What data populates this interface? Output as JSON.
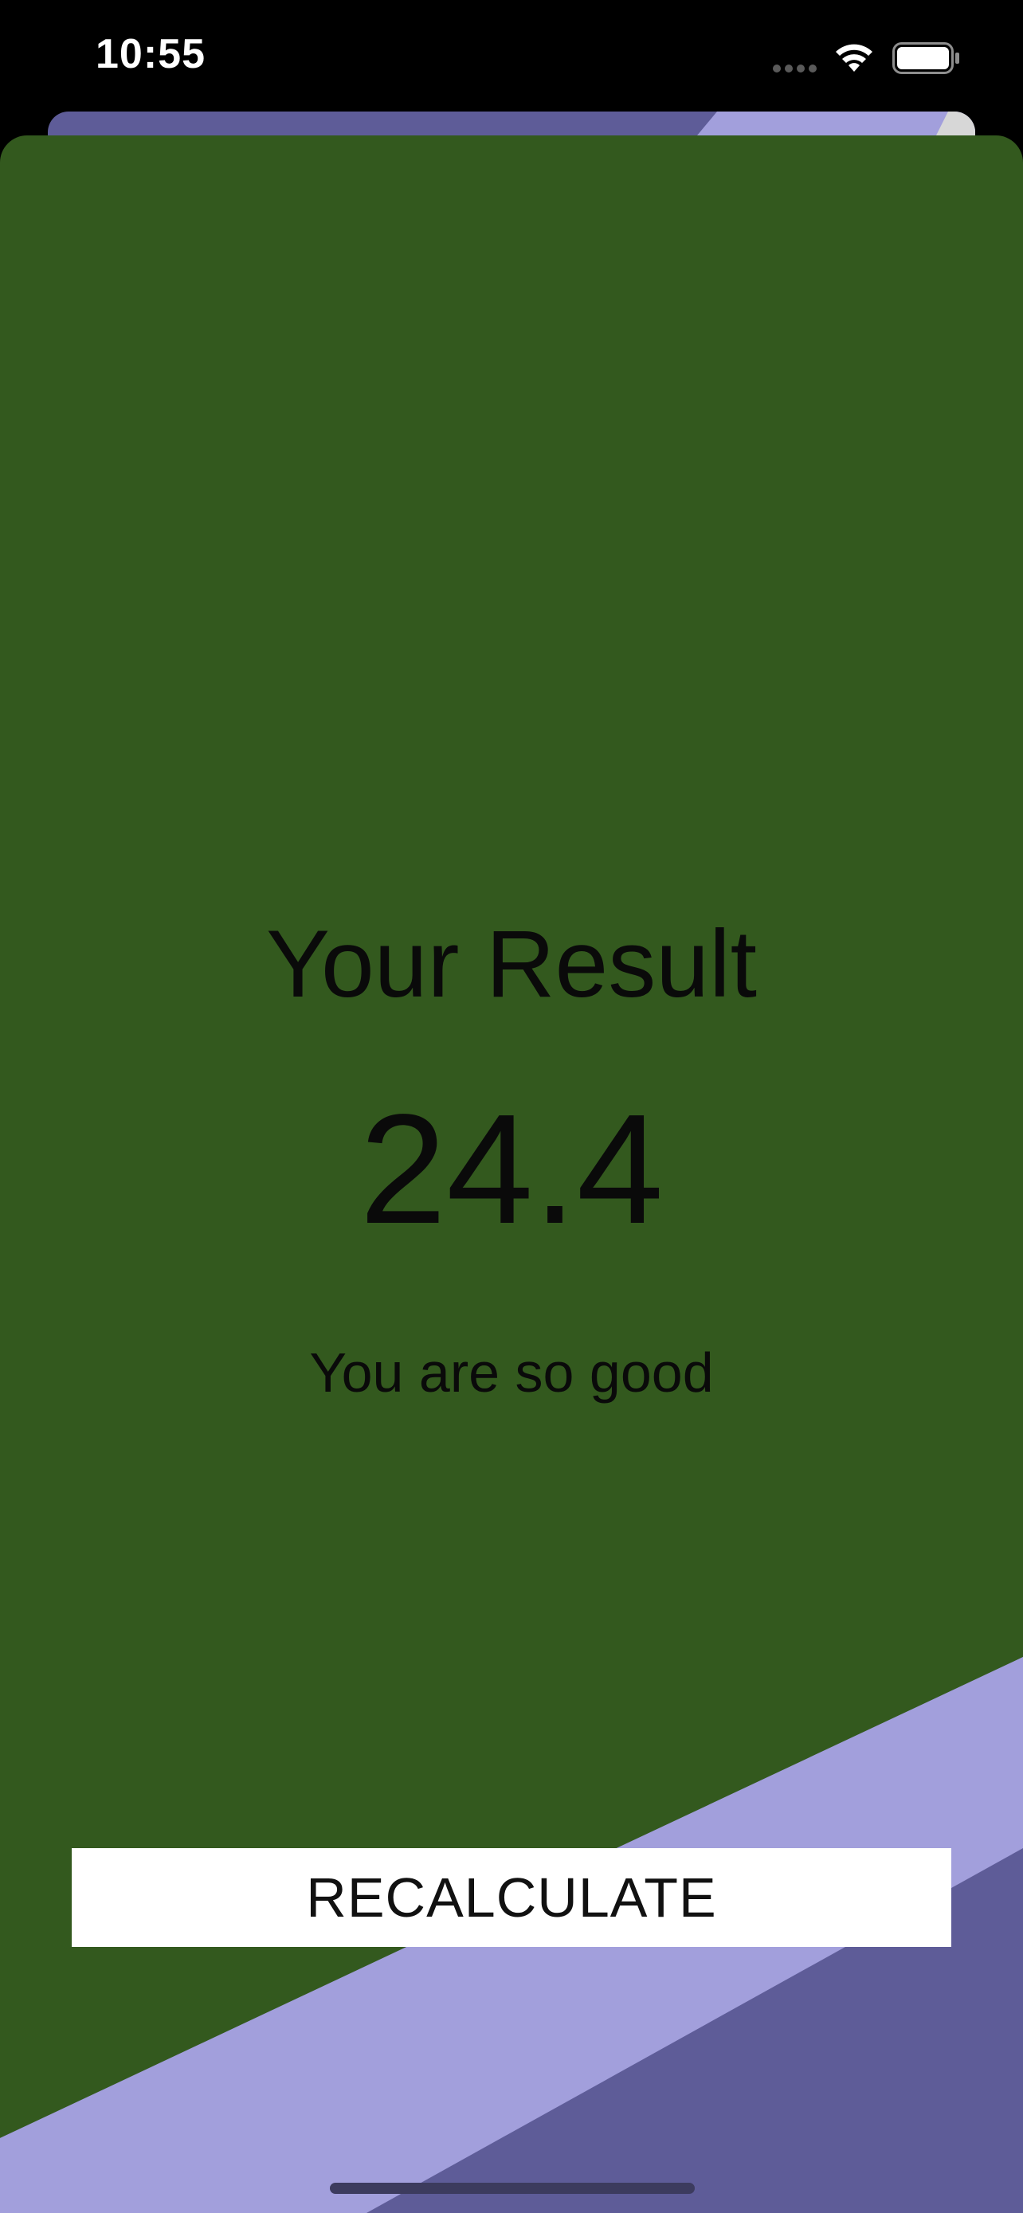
{
  "status_bar": {
    "time": "10:55",
    "icons": [
      "signal-dots-icon",
      "wifi-icon",
      "battery-icon"
    ]
  },
  "result": {
    "title": "Your Result",
    "value": "24.4",
    "message": "You are so good"
  },
  "actions": {
    "recalculate_label": "RECALCULATE"
  },
  "colors": {
    "sheet_background": "#33591e",
    "accent_light": "#a29fdc",
    "accent_dark": "#5e5c98",
    "text": "#0a0a0a",
    "button_background": "#ffffff"
  }
}
